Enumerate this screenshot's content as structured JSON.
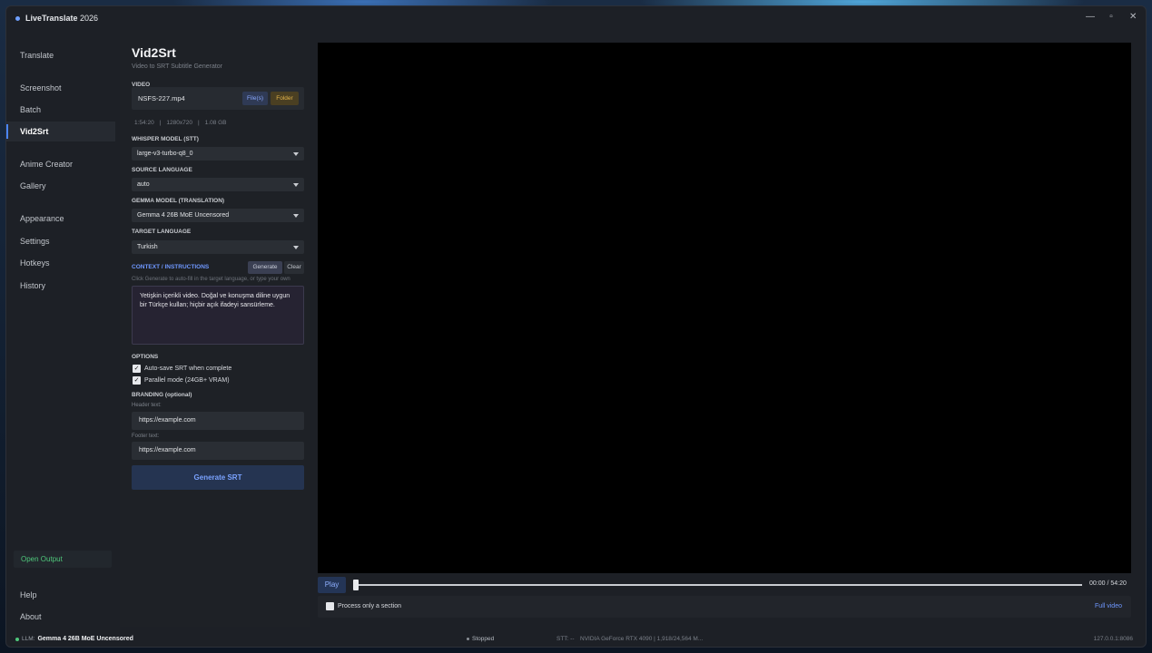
{
  "window": {
    "title_bold": "LiveTranslate",
    "title_rest": " 2026",
    "controls": {
      "minimize": "—",
      "maximize": "▫",
      "close": "✕"
    }
  },
  "sidebar": {
    "items": [
      {
        "label": "Translate"
      },
      {
        "label": "Screenshot"
      },
      {
        "label": "Batch"
      },
      {
        "label": "Vid2Srt"
      },
      {
        "label": "Anime Creator"
      },
      {
        "label": "Gallery"
      },
      {
        "label": "Appearance"
      },
      {
        "label": "Settings"
      },
      {
        "label": "Hotkeys"
      },
      {
        "label": "History"
      }
    ],
    "open_output": "Open Output",
    "help": "Help",
    "about": "About"
  },
  "panel": {
    "title": "Vid2Srt",
    "subtitle": "Video to SRT Subtitle Generator",
    "video_label": "VIDEO",
    "video_file": "NSFS-227.mp4",
    "files_button": "File(s)",
    "folder_button": "Folder",
    "meta": {
      "duration": "1:54:20",
      "resolution": "1280x720",
      "size": "1.08 GB",
      "sep": "|"
    },
    "whisper_label": "WHISPER MODEL (STT)",
    "whisper_value": "large-v3-turbo-q8_0",
    "source_label": "SOURCE LANGUAGE",
    "source_value": "auto",
    "gemma_label": "GEMMA MODEL (Translation)",
    "gemma_value": "Gemma 4 26B MoE Uncensored",
    "target_label": "TARGET LANGUAGE",
    "target_value": "Turkish",
    "context_label": "CONTEXT / INSTRUCTIONS",
    "generate_button": "Generate",
    "clear_button": "Clear",
    "context_hint": "Click Generate to auto-fill in the target language, or type your own",
    "context_text": "Yetişkin içerikli video. Doğal ve konuşma diline uygun bir Türkçe kullan; hiçbir açık ifadeyi sansürleme.",
    "options_label": "OPTIONS",
    "opt_autosave": "Auto-save SRT when complete",
    "opt_parallel": "Parallel mode (24GB+ VRAM)",
    "branding_label": "BRANDING (optional)",
    "header_label": "Header text:",
    "header_value": "https://example.com",
    "footer_label": "Footer text:",
    "footer_value": "https://example.com",
    "generate_srt": "Generate SRT"
  },
  "player": {
    "play": "Play",
    "time_current": "00:00",
    "time_sep": "/",
    "time_total": "54:20",
    "position": 0,
    "section_label": "Process only a section",
    "full_video": "Full video"
  },
  "status": {
    "llm_label": "LLM:",
    "llm_model": "Gemma 4 26B MoE Uncensored",
    "state": "Stopped",
    "stt": "STT: --",
    "gpu": "NVIDIA GeForce RTX 4090 | 1,918/24,564 M...",
    "ip": "127.0.0.1:8086"
  }
}
